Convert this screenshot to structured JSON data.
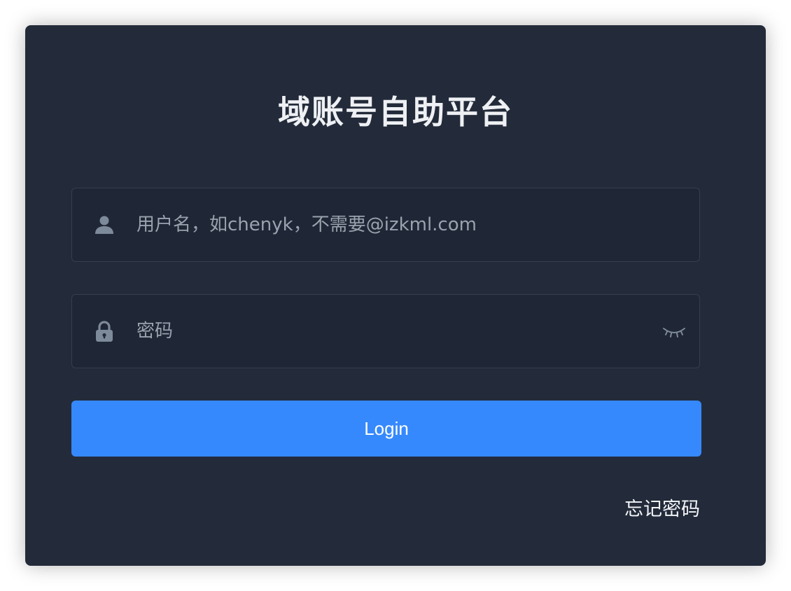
{
  "app": {
    "title": "域账号自助平台"
  },
  "form": {
    "username": {
      "value": "",
      "placeholder": "用户名，如chenyk，不需要@izkml.com",
      "icon": "user-icon"
    },
    "password": {
      "value": "",
      "placeholder": "密码",
      "icon": "lock-icon",
      "toggle_icon": "eye-closed-icon"
    },
    "login_label": "Login",
    "forgot_password_label": "忘记密码"
  },
  "colors": {
    "card_background": "#232b3a",
    "field_background": "#1f2635",
    "field_border": "#353e4f",
    "primary": "#3689fd",
    "icon": "#7d8a99"
  }
}
